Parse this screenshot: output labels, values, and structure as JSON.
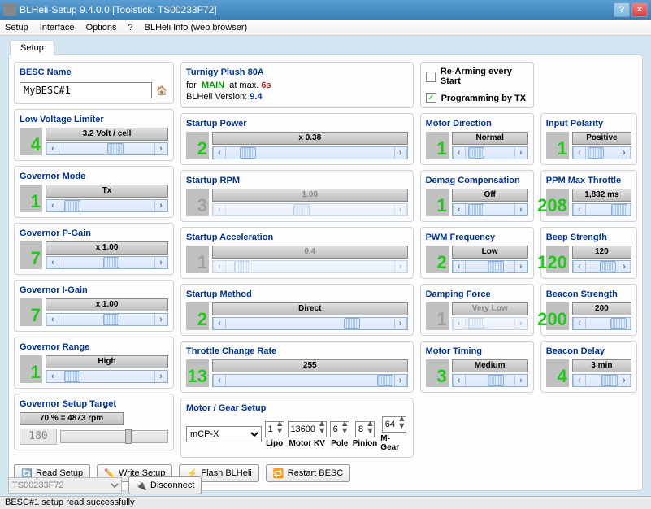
{
  "title": "BLHeli-Setup 9.4.0.0 [Toolstick: TS00233F72]",
  "menubar": [
    "Setup",
    "Interface",
    "Options",
    "?",
    "BLHeli Info (web browser)"
  ],
  "tab": "Setup",
  "besc": {
    "title": "BESC Name",
    "value": "MyBESC#1"
  },
  "info": {
    "name": "Turnigy Plush 80A",
    "for": "for",
    "main": "MAIN",
    "atmax": "at max.",
    "cells": "6s",
    "verlabel": "BLHeli Version:",
    "ver": "9.4"
  },
  "options": {
    "rearm": {
      "label": "Re-Arming every Start",
      "checked": false
    },
    "prog": {
      "label": "Programming by TX",
      "checked": true
    }
  },
  "col1": {
    "lvl": {
      "title": "Low Voltage Limiter",
      "num": "4",
      "on": true,
      "val": "3.2 Volt / cell",
      "pos": 50
    },
    "gmode": {
      "title": "Governor Mode",
      "num": "1",
      "on": true,
      "val": "Tx",
      "pos": 5
    },
    "gp": {
      "title": "Governor P-Gain",
      "num": "7",
      "on": true,
      "val": "x 1.00",
      "pos": 46
    },
    "gi": {
      "title": "Governor I-Gain",
      "num": "7",
      "on": true,
      "val": "x 1.00",
      "pos": 46
    },
    "grange": {
      "title": "Governor Range",
      "num": "1",
      "on": true,
      "val": "High",
      "pos": 5
    },
    "gtarget": {
      "title": "Governor Setup Target",
      "val": "70 % = 4873 rpm",
      "readout": "180"
    }
  },
  "col2": {
    "spow": {
      "title": "Startup Power",
      "num": "2",
      "on": true,
      "val": "x 0.38",
      "pos": 8
    },
    "srpm": {
      "title": "Startup RPM",
      "num": "3",
      "on": false,
      "val": "1.00",
      "pos": 40,
      "dim": true
    },
    "sacc": {
      "title": "Startup Acceleration",
      "num": "1",
      "on": false,
      "val": "0.4",
      "pos": 5,
      "dim": true
    },
    "smethod": {
      "title": "Startup Method",
      "num": "2",
      "on": true,
      "val": "Direct",
      "pos": 70
    },
    "tcr": {
      "title": "Throttle Change  Rate",
      "num": "13",
      "on": true,
      "val": "255",
      "pos": 90
    },
    "motor": {
      "title": "Motor / Gear Setup",
      "preset": "mCP-X",
      "lipo": "1",
      "lipol": "Lipo",
      "kv": "13600",
      "kvl": "Motor KV",
      "pole": "6",
      "polel": "Pole",
      "pinion": "8",
      "pinionl": "Pinion",
      "mg": "64",
      "mgl": "M-Gear"
    }
  },
  "col3": {
    "mdir": {
      "title": "Motor Direction",
      "num": "1",
      "on": true,
      "val": "Normal",
      "pos": 5
    },
    "demag": {
      "title": "Demag Compensation",
      "num": "1",
      "on": true,
      "val": "Off",
      "pos": 5
    },
    "pwm": {
      "title": "PWM Frequency",
      "num": "2",
      "on": true,
      "val": "Low",
      "pos": 45
    },
    "damp": {
      "title": "Damping Force",
      "num": "1",
      "on": false,
      "val": "Very Low",
      "pos": 5,
      "dim": true
    },
    "timing": {
      "title": "Motor Timing",
      "num": "3",
      "on": true,
      "val": "Medium",
      "pos": 45
    }
  },
  "col4": {
    "inpol": {
      "title": "Input Polarity",
      "num": "1",
      "on": true,
      "val": "Positive",
      "pos": 5
    },
    "ppm": {
      "title": "PPM Max Throttle",
      "num": "208",
      "on": true,
      "val": "1,832 ms",
      "pos": 80
    },
    "beep": {
      "title": "Beep Strength",
      "num": "120",
      "on": true,
      "val": "120",
      "pos": 45
    },
    "beacon": {
      "title": "Beacon Strength",
      "num": "200",
      "on": true,
      "val": "200",
      "pos": 78
    },
    "bdelay": {
      "title": "Beacon Delay",
      "num": "4",
      "on": true,
      "val": "3 min",
      "pos": 50
    }
  },
  "buttons": {
    "read": "Read Setup",
    "write": "Write Setup",
    "flash": "Flash BLHeli",
    "restart": "Restart BESC",
    "disconnect": "Disconnect"
  },
  "port": "TS00233F72",
  "status": "BESC#1 setup read successfully"
}
